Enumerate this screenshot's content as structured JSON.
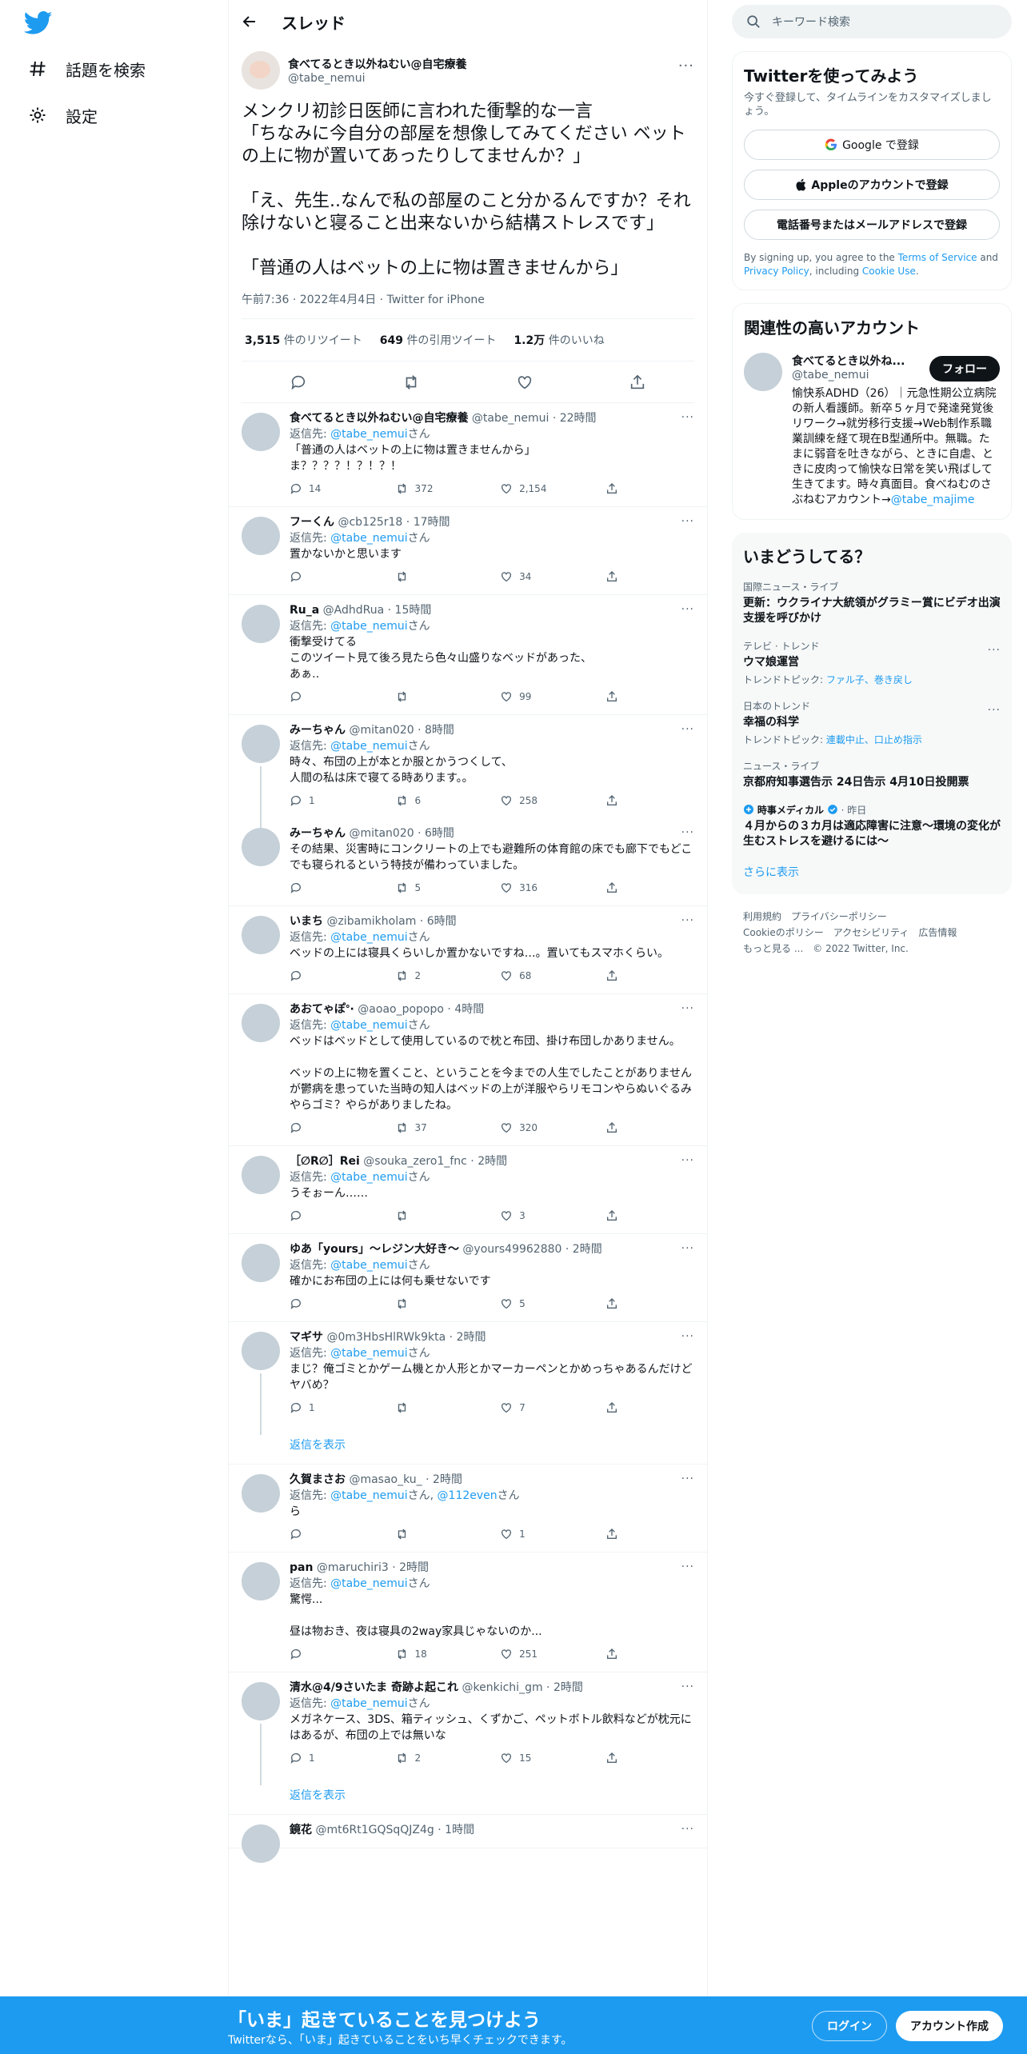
{
  "nav": {
    "explore_label": "話題を検索",
    "settings_label": "設定"
  },
  "header": {
    "title": "スレッド"
  },
  "focal": {
    "name": "食べてるとき以外ねむい@自宅療養",
    "handle": "@tabe_nemui",
    "text": "メンクリ初診日医師に言われた衝撃的な一言\n「ちなみに今自分の部屋を想像してみてください ベットの上に物が置いてあったりしてませんか？」\n\n「え、先生..なんで私の部屋のこと分かるんですか？それ除けないと寝ること出来ないから結構ストレスです」\n\n「普通の人はベットの上に物は置きませんから」",
    "meta": "午前7:36 · 2022年4月4日 · Twitter for iPhone",
    "retweets": "3,515",
    "retweets_label": "件のリツイート",
    "quotes": "649",
    "quotes_label": "件の引用ツイート",
    "likes": "1.2万",
    "likes_label": "件のいいね"
  },
  "replies": [
    {
      "name": "食べてるとき以外ねむい@自宅療養",
      "handle": "@tabe_nemui",
      "time": "22時間",
      "to": "@tabe_nemui",
      "text": "「普通の人はベットの上に物は置きませんから」\nま？？？？！？！？！",
      "reply": "14",
      "rt": "372",
      "like": "2,154"
    },
    {
      "name": "フーくん",
      "handle": "@cb125r18",
      "time": "17時間",
      "to": "@tabe_nemui",
      "text": "置かないかと思います",
      "reply": "",
      "rt": "",
      "like": "34"
    },
    {
      "name": "Ru_a",
      "handle": "@AdhdRua",
      "time": "15時間",
      "to": "@tabe_nemui",
      "text": "衝撃受けてる\nこのツイート見て後ろ見たら色々山盛りなベッドがあった、\nあぁ‥",
      "reply": "",
      "rt": "",
      "like": "99"
    },
    {
      "name": "みーちゃん",
      "handle": "@mitan020",
      "time": "8時間",
      "to": "@tabe_nemui",
      "text": "時々、布団の上が本とか服とかうつくして、\n人間の私は床で寝てる時あります。。",
      "reply": "1",
      "rt": "6",
      "like": "258"
    },
    {
      "name": "みーちゃん",
      "handle": "@mitan020",
      "time": "6時間",
      "to": "",
      "text": "その結果、災害時にコンクリートの上でも避難所の体育館の床でも廊下でもどこでも寝られるという特技が備わっていました。",
      "reply": "",
      "rt": "5",
      "like": "316"
    },
    {
      "name": "いまち",
      "handle": "@zibamikholam",
      "time": "6時間",
      "to": "@tabe_nemui",
      "text": "ベッドの上には寝具くらいしか置かないですね…。置いてもスマホくらい。",
      "reply": "",
      "rt": "2",
      "like": "68"
    },
    {
      "name": "あおてゃぽᐤ·",
      "handle": "@aoao_popopo",
      "time": "4時間",
      "to": "@tabe_nemui",
      "text": "ベッドはベッドとして使用しているので枕と布団、掛け布団しかありません。\n\nベッドの上に物を置くこと、ということを今までの人生でしたことがありませんが鬱病を患っていた当時の知人はベッドの上が洋服やらリモコンやらぬいぐるみやらゴミ？やらがありましたね。",
      "reply": "",
      "rt": "37",
      "like": "320"
    },
    {
      "name": "［∅R∅］Rei",
      "handle": "@souka_zero1_fnc",
      "time": "2時間",
      "to": "@tabe_nemui",
      "text": "うそぉーん……",
      "reply": "",
      "rt": "",
      "like": "3"
    },
    {
      "name": "ゆあ「yours」～レジン大好き～",
      "handle": "@yours49962880",
      "time": "2時間",
      "to": "@tabe_nemui",
      "text": "確かにお布団の上には何も乗せないです",
      "reply": "",
      "rt": "",
      "like": "5"
    },
    {
      "name": "マギサ",
      "handle": "@0m3HbsHlRWk9kta",
      "time": "2時間",
      "to": "@tabe_nemui",
      "text": "まじ？俺ゴミとかゲーム機とか人形とかマーカーペンとかめっちゃあるんだけどヤバめ？",
      "reply": "1",
      "rt": "",
      "like": "7"
    },
    {
      "name": "久賀まさお",
      "handle": "@masao_ku_",
      "time": "2時間",
      "to": "@tabe_nemui",
      "to2": "@112even",
      "text": "ら",
      "reply": "",
      "rt": "",
      "like": "1"
    },
    {
      "name": "pan",
      "handle": "@maruchiri3",
      "time": "2時間",
      "to": "@tabe_nemui",
      "text": "驚愕...\n\n昼は物おき、夜は寝具の2way家具じゃないのか...",
      "reply": "",
      "rt": "18",
      "like": "251"
    },
    {
      "name": "清水@4/9さいたま 奇跡よ起これ",
      "handle": "@kenkichi_gm",
      "time": "2時間",
      "to": "@tabe_nemui",
      "text": "メガネケース、3DS、箱ティッシュ、くずかご、ペットボトル飲料などが枕元にはあるが、布団の上では無いな",
      "reply": "1",
      "rt": "2",
      "like": "15"
    },
    {
      "name": "鏡花",
      "handle": "@mt6Rt1GQSqQJZ4g",
      "time": "1時間",
      "to": "",
      "text": "",
      "reply": "",
      "rt": "",
      "like": ""
    }
  ],
  "strings": {
    "reply_to": "返信先:",
    "san": "さん",
    "and": ", ",
    "show_replies": "返信を表示",
    "dot": " · "
  },
  "right": {
    "search_placeholder": "キーワード検索",
    "signup": {
      "title": "Twitterを使ってみよう",
      "sub": "今すぐ登録して、タイムラインをカスタマイズしましょう。",
      "google": "Google で登録",
      "apple": "Appleのアカウントで登録",
      "phone": "電話番号またはメールアドレスで登録",
      "tos1": "By signing up, you agree to the ",
      "tos_link": "Terms of Service",
      "tos2": " and ",
      "privacy_link": "Privacy Policy",
      "tos3": ", including ",
      "cookie_link": "Cookie Use",
      "tos4": "."
    },
    "related": {
      "title": "関連性の高いアカウント",
      "name": "食べてるとき以外ね...",
      "handle": "@tabe_nemui",
      "follow": "フォロー",
      "bio": "愉快系ADHD（26）｜元急性期公立病院の新人看護師。新卒５ヶ月で発達発覚後リワーク→就労移行支援→Web制作系職業訓練を経て現在B型通所中。無職。たまに弱音を吐きながら、ときに自虐、ときに皮肉って愉快な日常を笑い飛ばして生きてます。時々真面目。食べねむのさぶねむアカウント→",
      "bio_link": "@tabe_majime"
    },
    "trends": {
      "title": "いまどうしてる？",
      "items": [
        {
          "cat": "国際ニュース・ライブ",
          "title": "更新：ウクライナ大統領がグラミー賞にビデオ出演 支援を呼びかけ",
          "topic_label": "",
          "topic": ""
        },
        {
          "cat": "テレビ · トレンド",
          "title": "ウマ娘運営",
          "topic_label": "トレンドトピック: ",
          "topic": "ファル子、巻き戻し"
        },
        {
          "cat": "日本のトレンド",
          "title": "幸福の科学",
          "topic_label": "トレンドトピック: ",
          "topic": "連載中止、口止め指示"
        },
        {
          "cat": "ニュース・ライブ",
          "title": "京都府知事選告示 24日告示 4月10日投開票",
          "topic_label": "",
          "topic": ""
        },
        {
          "cat_name": "時事メディカル",
          "cat_time": " · 昨日",
          "title": "４月からの３カ月は適応障害に注意～環境の変化が生むストレスを避けるには～",
          "topic_label": "",
          "topic": ""
        }
      ],
      "more": "さらに表示"
    },
    "footer": {
      "terms": "利用規約",
      "privacy": "プライバシーポリシー",
      "cookie": "Cookieのポリシー",
      "access": "アクセシビリティ",
      "ads": "広告情報",
      "more": "もっと見る ...",
      "copy": "© 2022 Twitter, Inc."
    }
  },
  "bottom_bar": {
    "title": "「いま」起きていることを見つけよう",
    "sub": "Twitterなら、「いま」起きていることをいち早くチェックできます。",
    "login": "ログイン",
    "signup": "アカウント作成"
  },
  "colors": {
    "accent": "#1d9bf0",
    "text": "#0f1419",
    "muted": "#536471",
    "border": "#eff3f4"
  }
}
